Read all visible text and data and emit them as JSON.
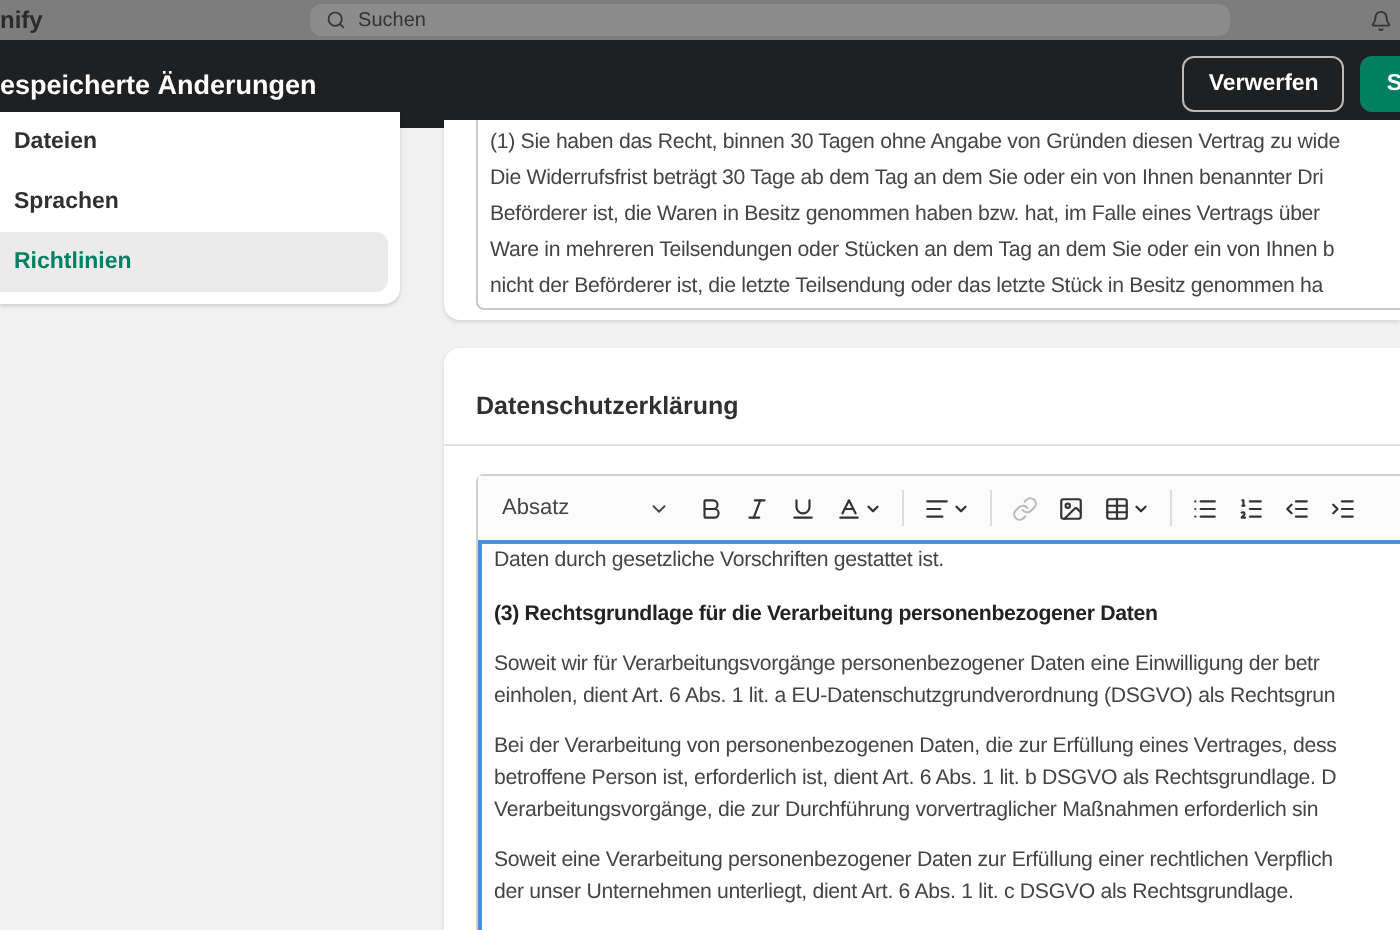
{
  "top_bar": {
    "logo": "nify",
    "search": {
      "placeholder": "Suchen"
    }
  },
  "save_bar": {
    "title": "espeicherte Änderungen",
    "buttons": [
      {
        "label": "Verwerfen",
        "kind": "secondary"
      },
      {
        "label": "S",
        "kind": "primary"
      }
    ]
  },
  "sidebar": {
    "items": [
      {
        "label": "Dateien",
        "selected": false
      },
      {
        "label": "Sprachen",
        "selected": false
      },
      {
        "label": "Richtlinien",
        "selected": true
      }
    ]
  },
  "withdrawal_text": {
    "lines": [
      "(1) Sie haben das Recht, binnen 30 Tagen ohne Angabe von Gründen diesen Vertrag zu wide",
      "Die Widerrufsfrist beträgt 30 Tage ab dem Tag an dem Sie oder ein von Ihnen benannter Dri",
      "Beförderer ist, die Waren in Besitz genommen haben bzw. hat, im Falle eines Vertrags über",
      "Ware in mehreren Teilsendungen oder Stücken an dem Tag an dem Sie oder ein von Ihnen b",
      "nicht der Beförderer ist, die letzte Teilsendung oder das letzte Stück in Besitz genommen ha"
    ]
  },
  "privacy": {
    "title": "Datenschutzerklärung",
    "toolbar": {
      "format": "Absatz",
      "tools": [
        {
          "kind": "bold",
          "disabled": false,
          "dropdown": false
        },
        {
          "kind": "italic",
          "disabled": false,
          "dropdown": false
        },
        {
          "kind": "underline",
          "disabled": false,
          "dropdown": false
        },
        {
          "kind": "text-color",
          "disabled": false,
          "dropdown": true
        },
        {
          "kind": "separator"
        },
        {
          "kind": "align",
          "disabled": false,
          "dropdown": true
        },
        {
          "kind": "separator"
        },
        {
          "kind": "link",
          "disabled": true,
          "dropdown": false
        },
        {
          "kind": "image",
          "disabled": false,
          "dropdown": false
        },
        {
          "kind": "table",
          "disabled": false,
          "dropdown": true
        },
        {
          "kind": "separator"
        },
        {
          "kind": "bullet-list",
          "disabled": false,
          "dropdown": false
        },
        {
          "kind": "numbered-list",
          "disabled": false,
          "dropdown": false
        },
        {
          "kind": "outdent",
          "disabled": false,
          "dropdown": false
        },
        {
          "kind": "indent",
          "disabled": false,
          "dropdown": false
        }
      ]
    },
    "blocks": [
      {
        "kind": "paragraph",
        "lines": [
          "Daten durch gesetzliche Vorschriften gestattet ist."
        ]
      },
      {
        "kind": "heading",
        "lines": [
          "(3) Rechtsgrundlage für die Verarbeitung personenbezogener Daten"
        ]
      },
      {
        "kind": "paragraph",
        "lines": [
          "Soweit wir für Verarbeitungsvorgänge personenbezogener Daten eine Einwilligung der betr",
          "einholen, dient Art. 6 Abs. 1 lit. a EU-Datenschutzgrundverordnung (DSGVO) als Rechtsgrun"
        ]
      },
      {
        "kind": "paragraph",
        "lines": [
          "Bei der Verarbeitung von personenbezogenen Daten, die zur Erfüllung eines Vertrages, dess",
          "betroffene Person ist, erforderlich ist, dient Art. 6 Abs. 1 lit. b DSGVO als Rechtsgrundlage. D",
          "Verarbeitungsvorgänge, die zur Durchführung vorvertraglicher Maßnahmen erforderlich sin"
        ]
      },
      {
        "kind": "paragraph",
        "lines": [
          "Soweit eine Verarbeitung personenbezogener Daten zur Erfüllung einer rechtlichen Verpflich",
          "der unser Unternehmen unterliegt, dient Art. 6 Abs. 1 lit. c DSGVO als Rechtsgrundlage."
        ]
      }
    ]
  }
}
